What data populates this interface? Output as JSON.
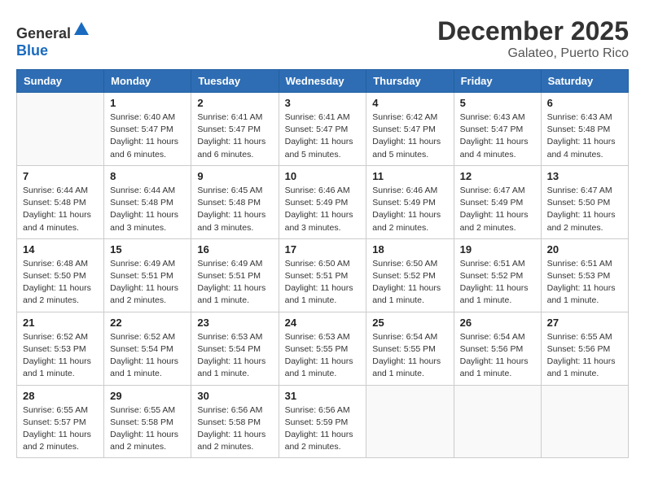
{
  "header": {
    "logo_general": "General",
    "logo_blue": "Blue",
    "month": "December 2025",
    "location": "Galateo, Puerto Rico"
  },
  "weekdays": [
    "Sunday",
    "Monday",
    "Tuesday",
    "Wednesday",
    "Thursday",
    "Friday",
    "Saturday"
  ],
  "weeks": [
    [
      {
        "day": "",
        "info": ""
      },
      {
        "day": "1",
        "info": "Sunrise: 6:40 AM\nSunset: 5:47 PM\nDaylight: 11 hours\nand 6 minutes."
      },
      {
        "day": "2",
        "info": "Sunrise: 6:41 AM\nSunset: 5:47 PM\nDaylight: 11 hours\nand 6 minutes."
      },
      {
        "day": "3",
        "info": "Sunrise: 6:41 AM\nSunset: 5:47 PM\nDaylight: 11 hours\nand 5 minutes."
      },
      {
        "day": "4",
        "info": "Sunrise: 6:42 AM\nSunset: 5:47 PM\nDaylight: 11 hours\nand 5 minutes."
      },
      {
        "day": "5",
        "info": "Sunrise: 6:43 AM\nSunset: 5:47 PM\nDaylight: 11 hours\nand 4 minutes."
      },
      {
        "day": "6",
        "info": "Sunrise: 6:43 AM\nSunset: 5:48 PM\nDaylight: 11 hours\nand 4 minutes."
      }
    ],
    [
      {
        "day": "7",
        "info": "Sunrise: 6:44 AM\nSunset: 5:48 PM\nDaylight: 11 hours\nand 4 minutes."
      },
      {
        "day": "8",
        "info": "Sunrise: 6:44 AM\nSunset: 5:48 PM\nDaylight: 11 hours\nand 3 minutes."
      },
      {
        "day": "9",
        "info": "Sunrise: 6:45 AM\nSunset: 5:48 PM\nDaylight: 11 hours\nand 3 minutes."
      },
      {
        "day": "10",
        "info": "Sunrise: 6:46 AM\nSunset: 5:49 PM\nDaylight: 11 hours\nand 3 minutes."
      },
      {
        "day": "11",
        "info": "Sunrise: 6:46 AM\nSunset: 5:49 PM\nDaylight: 11 hours\nand 2 minutes."
      },
      {
        "day": "12",
        "info": "Sunrise: 6:47 AM\nSunset: 5:49 PM\nDaylight: 11 hours\nand 2 minutes."
      },
      {
        "day": "13",
        "info": "Sunrise: 6:47 AM\nSunset: 5:50 PM\nDaylight: 11 hours\nand 2 minutes."
      }
    ],
    [
      {
        "day": "14",
        "info": "Sunrise: 6:48 AM\nSunset: 5:50 PM\nDaylight: 11 hours\nand 2 minutes."
      },
      {
        "day": "15",
        "info": "Sunrise: 6:49 AM\nSunset: 5:51 PM\nDaylight: 11 hours\nand 2 minutes."
      },
      {
        "day": "16",
        "info": "Sunrise: 6:49 AM\nSunset: 5:51 PM\nDaylight: 11 hours\nand 1 minute."
      },
      {
        "day": "17",
        "info": "Sunrise: 6:50 AM\nSunset: 5:51 PM\nDaylight: 11 hours\nand 1 minute."
      },
      {
        "day": "18",
        "info": "Sunrise: 6:50 AM\nSunset: 5:52 PM\nDaylight: 11 hours\nand 1 minute."
      },
      {
        "day": "19",
        "info": "Sunrise: 6:51 AM\nSunset: 5:52 PM\nDaylight: 11 hours\nand 1 minute."
      },
      {
        "day": "20",
        "info": "Sunrise: 6:51 AM\nSunset: 5:53 PM\nDaylight: 11 hours\nand 1 minute."
      }
    ],
    [
      {
        "day": "21",
        "info": "Sunrise: 6:52 AM\nSunset: 5:53 PM\nDaylight: 11 hours\nand 1 minute."
      },
      {
        "day": "22",
        "info": "Sunrise: 6:52 AM\nSunset: 5:54 PM\nDaylight: 11 hours\nand 1 minute."
      },
      {
        "day": "23",
        "info": "Sunrise: 6:53 AM\nSunset: 5:54 PM\nDaylight: 11 hours\nand 1 minute."
      },
      {
        "day": "24",
        "info": "Sunrise: 6:53 AM\nSunset: 5:55 PM\nDaylight: 11 hours\nand 1 minute."
      },
      {
        "day": "25",
        "info": "Sunrise: 6:54 AM\nSunset: 5:55 PM\nDaylight: 11 hours\nand 1 minute."
      },
      {
        "day": "26",
        "info": "Sunrise: 6:54 AM\nSunset: 5:56 PM\nDaylight: 11 hours\nand 1 minute."
      },
      {
        "day": "27",
        "info": "Sunrise: 6:55 AM\nSunset: 5:56 PM\nDaylight: 11 hours\nand 1 minute."
      }
    ],
    [
      {
        "day": "28",
        "info": "Sunrise: 6:55 AM\nSunset: 5:57 PM\nDaylight: 11 hours\nand 2 minutes."
      },
      {
        "day": "29",
        "info": "Sunrise: 6:55 AM\nSunset: 5:58 PM\nDaylight: 11 hours\nand 2 minutes."
      },
      {
        "day": "30",
        "info": "Sunrise: 6:56 AM\nSunset: 5:58 PM\nDaylight: 11 hours\nand 2 minutes."
      },
      {
        "day": "31",
        "info": "Sunrise: 6:56 AM\nSunset: 5:59 PM\nDaylight: 11 hours\nand 2 minutes."
      },
      {
        "day": "",
        "info": ""
      },
      {
        "day": "",
        "info": ""
      },
      {
        "day": "",
        "info": ""
      }
    ]
  ]
}
